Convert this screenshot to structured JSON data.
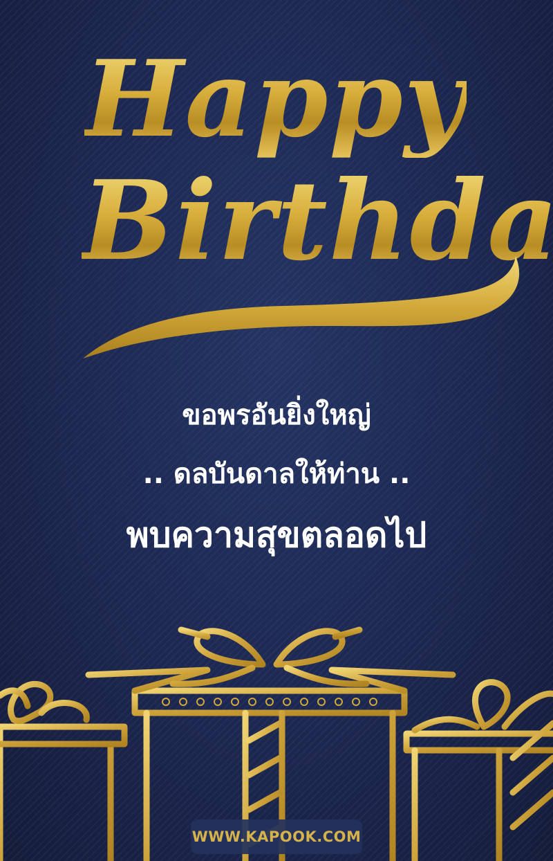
{
  "card": {
    "title_line_1": "Happy",
    "title_line_2": "Birthday",
    "message_line_1": "ขอพรอันยิ่งใหญ่",
    "message_line_2": ".. ดลบันดาลให้ท่าน ..",
    "message_line_3": "พบความสุขตลอดไป",
    "website": "WWW.KAPOOK.COM"
  },
  "colors": {
    "background": "#1d2a50",
    "gold": "#d9b545",
    "message_text": "#ffffff"
  },
  "decorations": [
    "gold-script-swoosh",
    "gift-box-outline-left",
    "gift-box-outline-center",
    "gift-box-outline-right"
  ]
}
